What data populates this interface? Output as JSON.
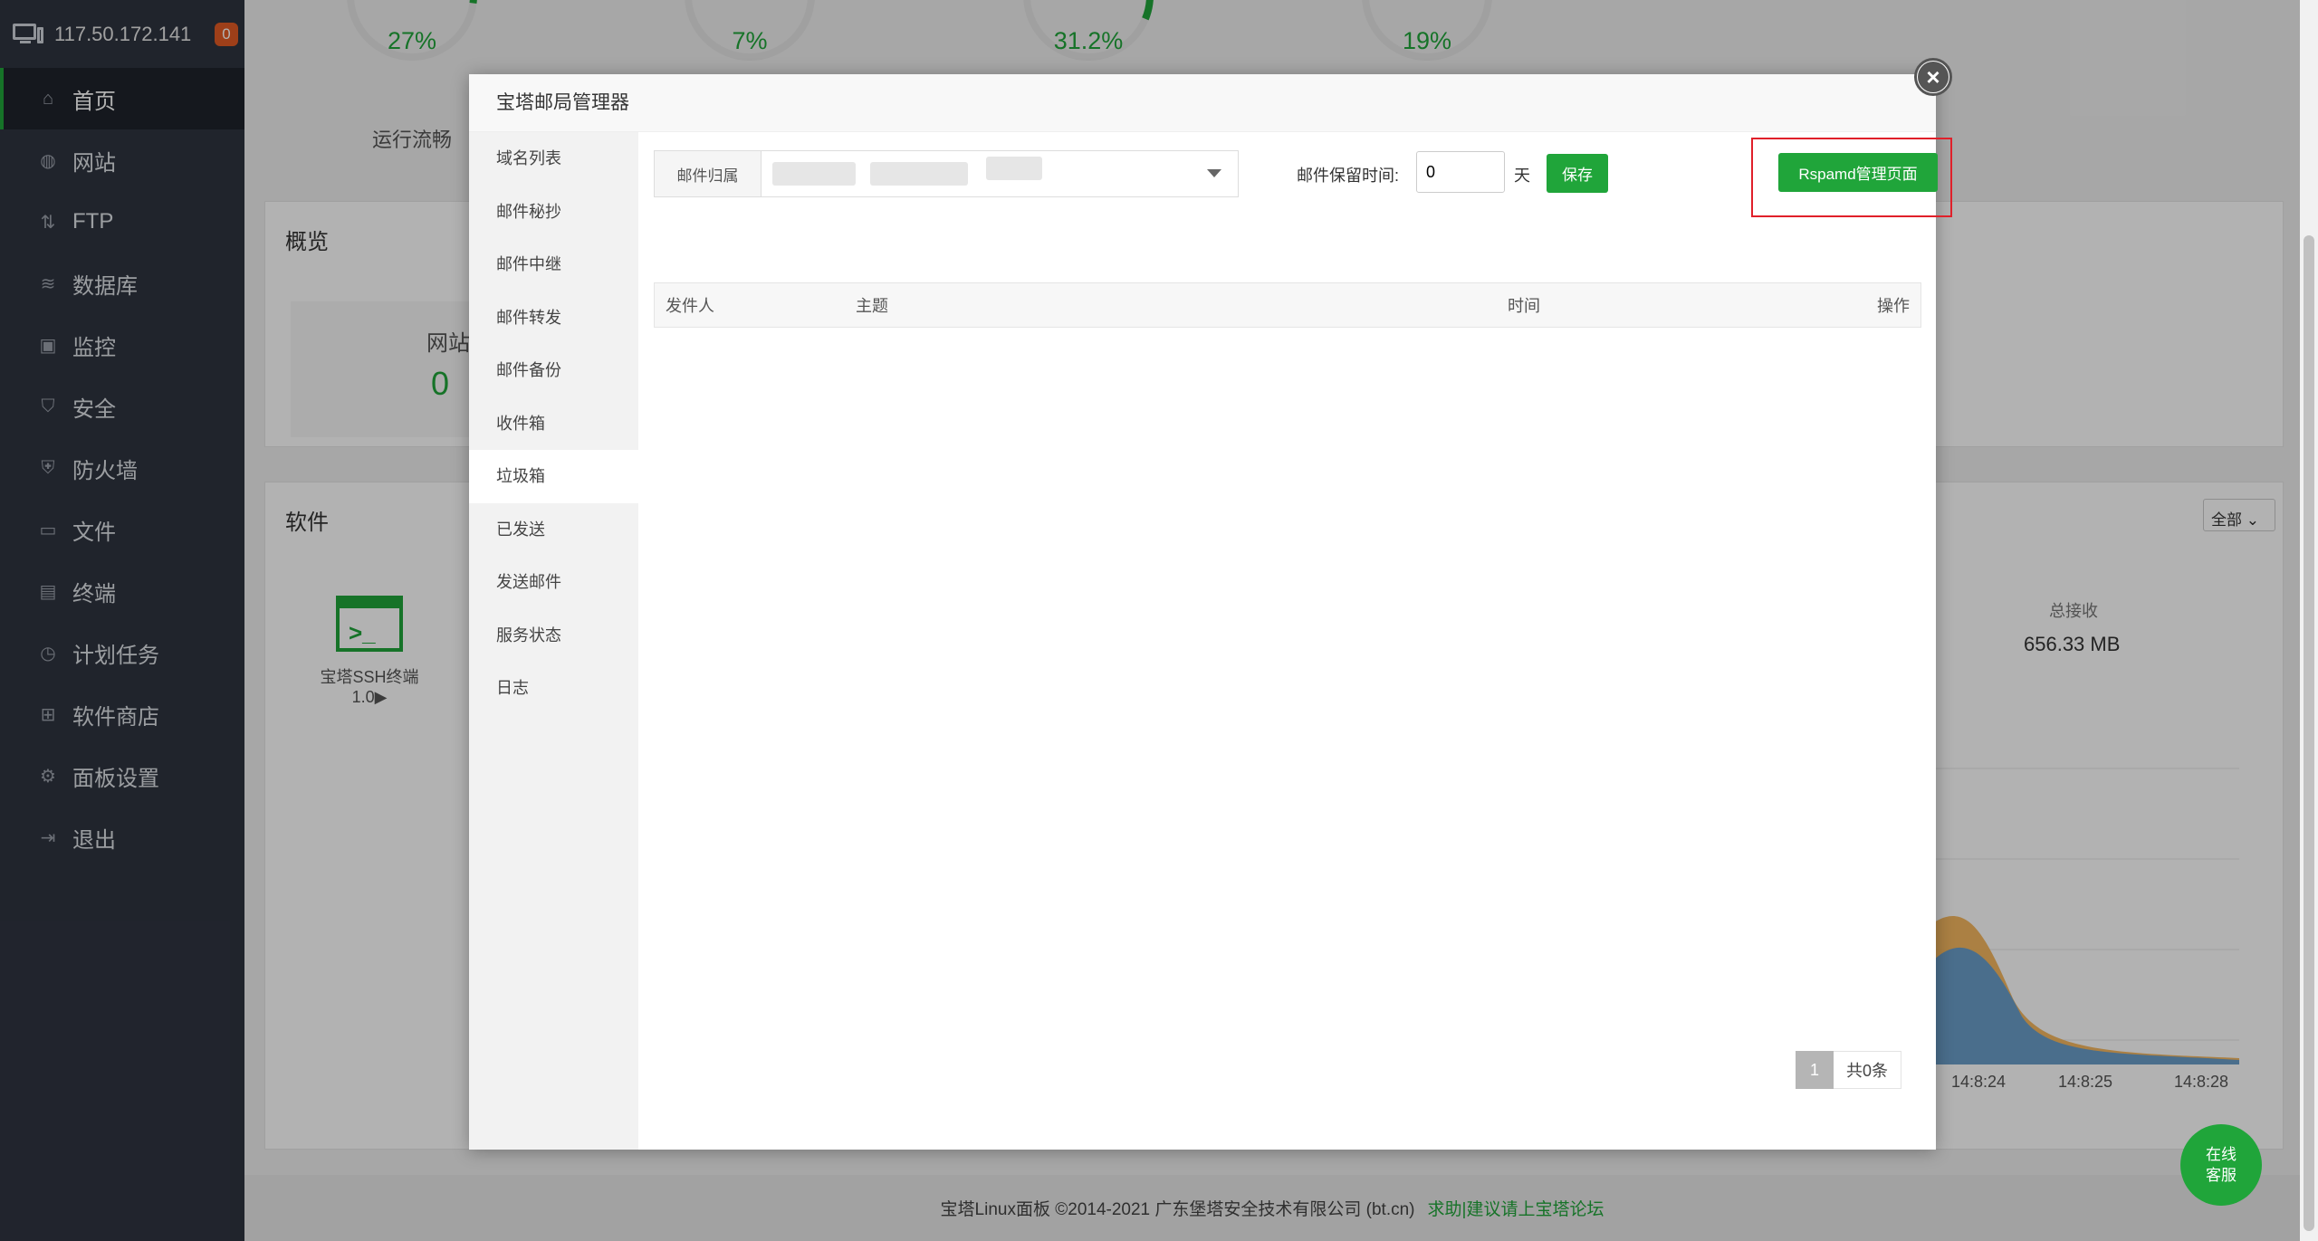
{
  "header": {
    "server_ip": "117.50.172.141",
    "notify_count": "0"
  },
  "sidebar": {
    "items": [
      {
        "label": "首页",
        "icon": "home-icon"
      },
      {
        "label": "网站",
        "icon": "globe-icon"
      },
      {
        "label": "FTP",
        "icon": "ftp-icon"
      },
      {
        "label": "数据库",
        "icon": "database-icon"
      },
      {
        "label": "监控",
        "icon": "monitor-icon"
      },
      {
        "label": "安全",
        "icon": "shield-icon"
      },
      {
        "label": "防火墙",
        "icon": "firewall-icon"
      },
      {
        "label": "文件",
        "icon": "folder-icon"
      },
      {
        "label": "终端",
        "icon": "terminal-icon"
      },
      {
        "label": "计划任务",
        "icon": "clock-icon"
      },
      {
        "label": "软件商店",
        "icon": "grid-icon"
      },
      {
        "label": "面板设置",
        "icon": "gear-icon"
      },
      {
        "label": "退出",
        "icon": "logout-icon"
      }
    ]
  },
  "background": {
    "gauges": [
      {
        "value": "27%",
        "label": "运行流畅",
        "fraction": 0.27
      },
      {
        "value": "7%",
        "label": "",
        "fraction": 0.07
      },
      {
        "value": "31.2%",
        "label": "",
        "fraction": 0.312
      },
      {
        "value": "19%",
        "label": "",
        "fraction": 0.19
      }
    ],
    "overview_title": "概览",
    "overview_site_label": "网站",
    "overview_site_count": "0",
    "software_title": "软件",
    "software_item": "宝塔SSH终端 1.0▶",
    "filter_label": "全部",
    "total_received_label": "总接收",
    "total_received_value": "656.33 MB",
    "chart_ticks": [
      "14:8:24",
      "14:8:25",
      "14:8:28"
    ]
  },
  "dialog": {
    "title": "宝塔邮局管理器",
    "nav": [
      "域名列表",
      "邮件秘抄",
      "邮件中继",
      "邮件转发",
      "邮件备份",
      "收件箱",
      "垃圾箱",
      "已发送",
      "发送邮件",
      "服务状态",
      "日志"
    ],
    "active_nav_index": 6,
    "mail_owner_label": "邮件归属",
    "keep_time_label": "邮件保留时间:",
    "keep_time_value": "0",
    "keep_time_unit": "天",
    "save_label": "保存",
    "rspamd_label": "Rspamd管理页面",
    "columns": {
      "sender": "发件人",
      "subject": "主题",
      "time": "时间",
      "action": "操作"
    },
    "pager": {
      "current": "1",
      "total": "共0条"
    }
  },
  "footer": {
    "copyright": "宝塔Linux面板 ©2014-2021 广东堡塔安全技术有限公司 (bt.cn)",
    "link": "求助|建议请上宝塔论坛"
  },
  "chat": {
    "line1": "在线",
    "line2": "客服"
  }
}
